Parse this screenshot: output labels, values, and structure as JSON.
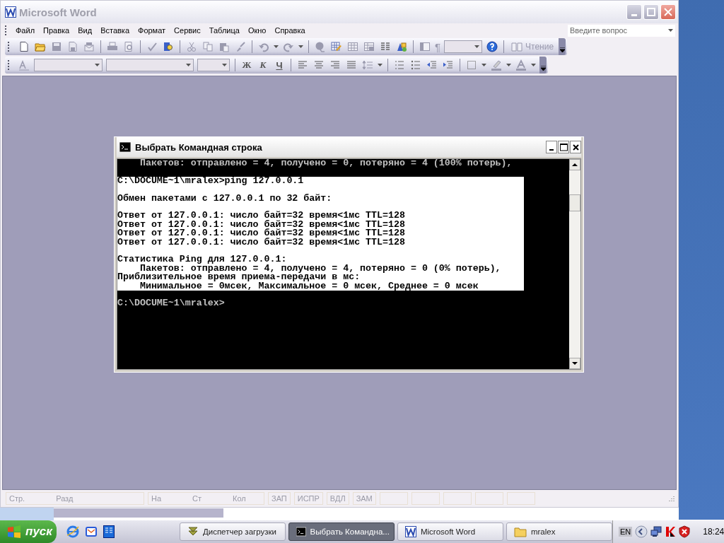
{
  "word_window": {
    "title": "Microsoft Word",
    "menu": [
      "Файл",
      "Правка",
      "Вид",
      "Вставка",
      "Формат",
      "Сервис",
      "Таблица",
      "Окно",
      "Справка"
    ],
    "help_search": {
      "placeholder": "Введите вопрос"
    },
    "standard_toolbar": {
      "paragraph_mark": "¶",
      "reading_button": "Чтение"
    },
    "formatting_toolbar": {
      "bold": "Ж",
      "italic": "К",
      "underline": "Ч"
    },
    "status_bar": {
      "panels": [
        {
          "fields": [
            {
              "label": "Стр.",
              "disabled": true
            },
            {
              "label": "Разд",
              "disabled": true
            }
          ]
        },
        {
          "fields": [
            {
              "label": "На",
              "disabled": true
            },
            {
              "label": "Ст",
              "disabled": true
            },
            {
              "label": "Кол",
              "disabled": true
            }
          ]
        },
        {
          "fields": [
            {
              "label": "ЗАП",
              "disabled": true
            }
          ]
        },
        {
          "fields": [
            {
              "label": "ИСПР",
              "disabled": true
            }
          ]
        },
        {
          "fields": [
            {
              "label": "ВДЛ",
              "disabled": true
            }
          ]
        },
        {
          "fields": [
            {
              "label": "ЗАМ",
              "disabled": true
            }
          ]
        }
      ]
    }
  },
  "console_window": {
    "title": "Выбрать Командная строка",
    "blocks": [
      {
        "selected": false,
        "lines": [
          "    Пакетов: отправлено = 4, получено = 0, потеряно = 4 (100% потерь),"
        ]
      },
      {
        "selected": true,
        "lines": [
          "C:\\DOCUME~1\\mralex>ping 127.0.0.1"
        ]
      },
      {
        "selected": true,
        "lines": [
          "Обмен пакетами с 127.0.0.1 по 32 байт:"
        ]
      },
      {
        "selected": true,
        "lines": [
          "Ответ от 127.0.0.1: число байт=32 время<1мс TTL=128",
          "Ответ от 127.0.0.1: число байт=32 время<1мс TTL=128",
          "Ответ от 127.0.0.1: число байт=32 время<1мс TTL=128",
          "Ответ от 127.0.0.1: число байт=32 время<1мс TTL=128"
        ]
      },
      {
        "selected": true,
        "lines": [
          "Статистика Ping для 127.0.0.1:",
          "    Пакетов: отправлено = 4, получено = 4, потеряно = 0 (0% потерь),",
          "Приблизительное время приема-передачи в мс:",
          "    Минимальное = 0мсек, Максимальное = 0 мсек, Среднее = 0 мсек"
        ]
      },
      {
        "selected": false,
        "lines": [
          "C:\\DOCUME~1\\mralex>"
        ]
      }
    ]
  },
  "taskbar": {
    "start": "пуск",
    "tasks": [
      {
        "kind": "download",
        "label": "Диспетчер загрузки",
        "selected": false
      },
      {
        "kind": "console",
        "label": "Выбрать Командна...",
        "selected": true
      },
      {
        "kind": "word",
        "label": "Microsoft Word",
        "selected": false
      },
      {
        "kind": "folder",
        "label": "mralex",
        "selected": false
      }
    ],
    "tray": {
      "language": "EN",
      "clock": "18:24"
    }
  }
}
